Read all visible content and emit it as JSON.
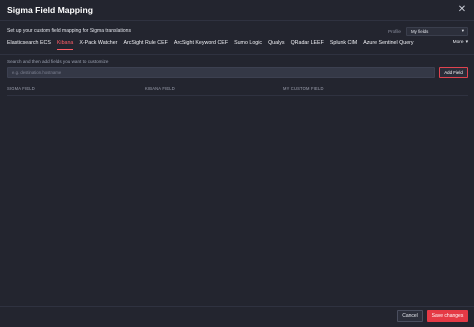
{
  "modal": {
    "title": "Sigma Field Mapping"
  },
  "header": {
    "subtitle": "Set up your custom field mapping for Sigma translations",
    "profile_label": "Profile",
    "profile_value": "My fields"
  },
  "tabs": [
    {
      "label": "Elasticsearch ECS",
      "active": false
    },
    {
      "label": "Kibana",
      "active": true
    },
    {
      "label": "X-Pack Watcher",
      "active": false
    },
    {
      "label": "ArcSight Rule CEF",
      "active": false
    },
    {
      "label": "ArcSight Keyword CEF",
      "active": false
    },
    {
      "label": "Sumo Logic",
      "active": false
    },
    {
      "label": "Qualys",
      "active": false
    },
    {
      "label": "QRadar LEEF",
      "active": false
    },
    {
      "label": "Splunk CIM",
      "active": false
    },
    {
      "label": "Azure Sentinel Query",
      "active": false
    }
  ],
  "more_label": "More",
  "search": {
    "hint": "Search and then add fields you want to customize",
    "placeholder": "e.g. destination.hostname",
    "add_label": "Add Field"
  },
  "table": {
    "columns": [
      "SIGMA FIELD",
      "KIBANA FIELD",
      "MY CUSTOM FIELD"
    ]
  },
  "footer": {
    "cancel_label": "Cancel",
    "save_label": "Save changes"
  },
  "colors": {
    "accent": "#ff5c66",
    "save_button": "#e53945",
    "background": "#23252f"
  },
  "icons": {
    "close": "close-icon",
    "dropdown": "chevron-down-icon",
    "more": "chevron-down-icon"
  }
}
